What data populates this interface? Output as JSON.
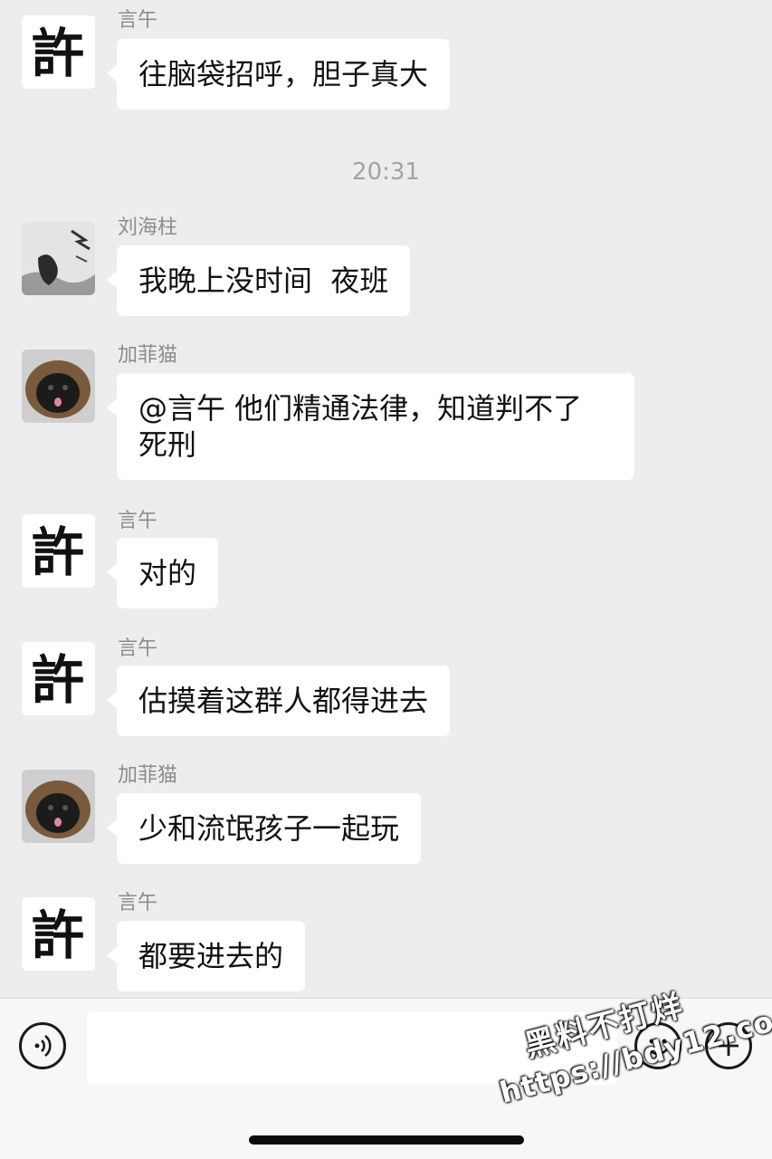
{
  "messages": [
    {
      "sender": "言午",
      "text": "往脑袋招呼，胆子真大",
      "avatar": "xu-calligraphy-avatar"
    },
    {
      "sender": "刘海柱",
      "text": "我晚上没时间  夜班",
      "avatar": "ink-painting-avatar"
    },
    {
      "sender": "加菲猫",
      "text": "@言午 他们精通法律，知道判不了\n死刑",
      "avatar": "pekingese-dog-avatar"
    },
    {
      "sender": "言午",
      "text": "对的",
      "avatar": "xu-calligraphy-avatar"
    },
    {
      "sender": "言午",
      "text": "估摸着这群人都得进去",
      "avatar": "xu-calligraphy-avatar"
    },
    {
      "sender": "加菲猫",
      "text": "少和流氓孩子一起玩",
      "avatar": "pekingese-dog-avatar"
    },
    {
      "sender": "言午",
      "text": "都要进去的",
      "avatar": "xu-calligraphy-avatar"
    }
  ],
  "timestamp": "20:31",
  "avatar_glyph": "許",
  "input_bar": {
    "voice_button": "voice-icon",
    "emoji_button": "emoji-icon",
    "more_button": "plus-icon",
    "text_value": ""
  },
  "watermark": {
    "line1": "黑料不打烊",
    "line2": "https://bdy12.co"
  },
  "colors": {
    "background": "#ededed",
    "bubble": "#ffffff",
    "sender": "#8c8c8c"
  }
}
